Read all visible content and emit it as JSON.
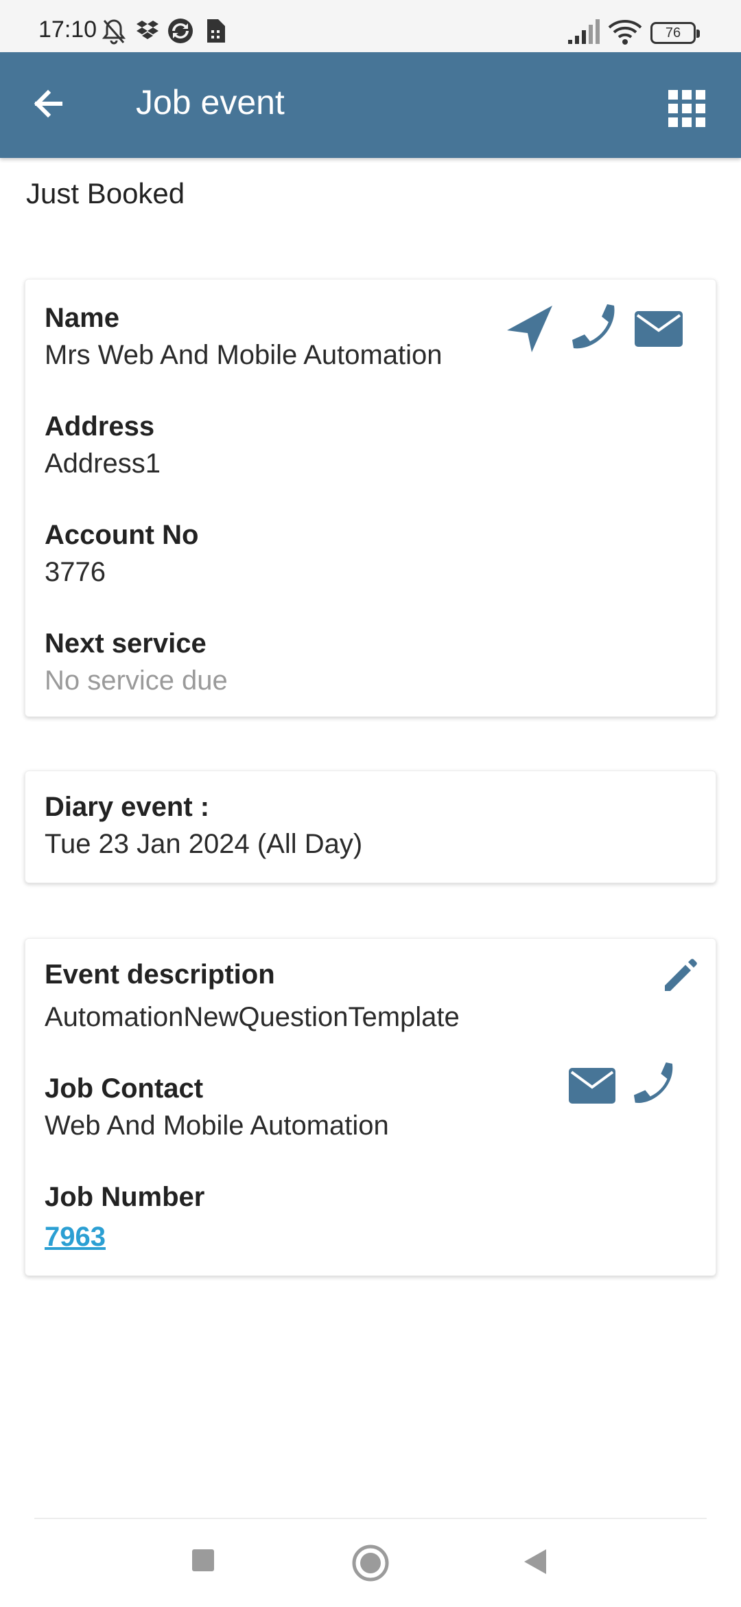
{
  "status_bar": {
    "time": "17:10",
    "battery": "76",
    "icons": [
      "bell-off-icon",
      "dropbox-icon",
      "sync-icon",
      "sim-icon",
      "signal-icon",
      "wifi-icon",
      "battery-icon"
    ]
  },
  "app_bar": {
    "title": "Job event",
    "back_icon": "arrow-left-icon",
    "menu_icon": "grid-apps-icon"
  },
  "status_heading": "Just Booked",
  "customer_card": {
    "name_label": "Name",
    "name_value": "Mrs Web And Mobile Automation",
    "address_label": "Address",
    "address_value": "Address1",
    "account_label": "Account No",
    "account_value": "3776",
    "next_service_label": "Next service",
    "next_service_value": "No service due",
    "actions": [
      "navigate-icon",
      "phone-icon",
      "email-icon"
    ]
  },
  "diary_card": {
    "label": "Diary event :",
    "value": "Tue 23 Jan 2024 (All Day)"
  },
  "event_card": {
    "description_label": "Event description",
    "description_value": "AutomationNewQuestionTemplate",
    "contact_label": "Job Contact",
    "contact_value": "Web And Mobile Automation",
    "job_number_label": "Job Number",
    "job_number_value": "7963",
    "actions": [
      "edit-icon",
      "email-icon",
      "phone-icon"
    ]
  },
  "colors": {
    "primary": "#477597",
    "link": "#2b9fd3",
    "muted": "#9a9a9a"
  },
  "nav_bar": [
    "recents-square-icon",
    "home-circle-icon",
    "back-triangle-icon"
  ]
}
